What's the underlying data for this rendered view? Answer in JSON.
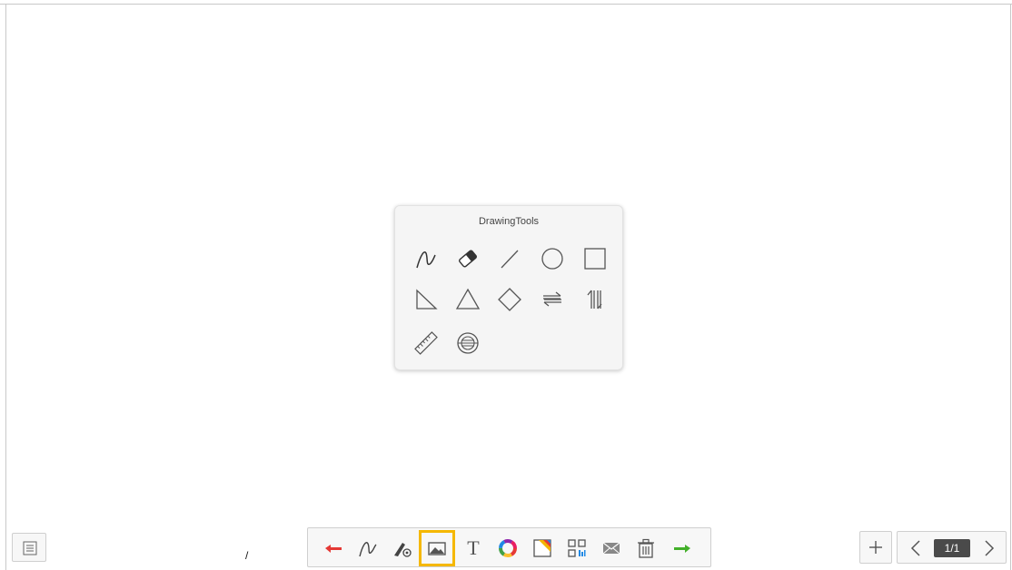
{
  "drawing_tools": {
    "title": "DrawingTools",
    "tools": [
      {
        "name": "pen-icon"
      },
      {
        "name": "eraser-icon"
      },
      {
        "name": "line-icon"
      },
      {
        "name": "circle-icon"
      },
      {
        "name": "square-icon"
      },
      {
        "name": "right-triangle-icon"
      },
      {
        "name": "triangle-icon"
      },
      {
        "name": "diamond-icon"
      },
      {
        "name": "swap-horizontal-icon"
      },
      {
        "name": "swap-vertical-icon"
      },
      {
        "name": "ruler-icon"
      },
      {
        "name": "protractor-icon"
      }
    ]
  },
  "toolbar": {
    "tools": [
      {
        "name": "undo-icon",
        "color": "#e53935"
      },
      {
        "name": "pen-icon"
      },
      {
        "name": "pen-settings-icon"
      },
      {
        "name": "image-icon",
        "selected": true
      },
      {
        "name": "text-icon",
        "glyph": "T"
      },
      {
        "name": "color-wheel-icon"
      },
      {
        "name": "background-icon"
      },
      {
        "name": "qr-code-icon"
      },
      {
        "name": "mail-icon"
      },
      {
        "name": "trash-icon"
      },
      {
        "name": "redo-icon",
        "color": "#43b02a"
      }
    ],
    "selection_color": "#f5b800"
  },
  "stray_mark": "/",
  "pager": {
    "add_label": "+",
    "prev_label": "<",
    "page_indicator": "1/1",
    "next_label": ">"
  },
  "menu": {
    "icon": "list-icon"
  }
}
